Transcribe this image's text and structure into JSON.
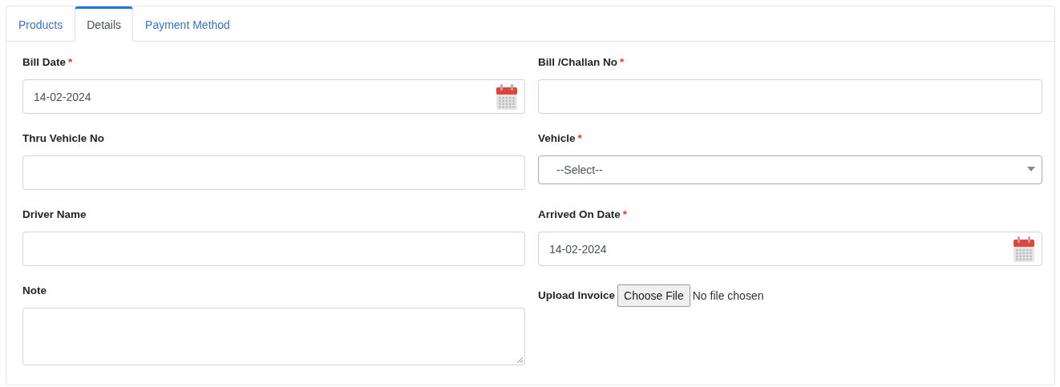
{
  "tabs": [
    {
      "label": "Products",
      "selected": false
    },
    {
      "label": "Details",
      "selected": true
    },
    {
      "label": "Payment Method",
      "selected": false
    }
  ],
  "fields": [
    {
      "kind": "date",
      "label": "Bill Date",
      "required_mark": "*",
      "value": "14-02-2024"
    },
    {
      "kind": "text",
      "label": "Bill /Challan No",
      "required_mark": "*"
    },
    {
      "kind": "text",
      "label": "Thru Vehicle No"
    },
    {
      "kind": "select",
      "label": "Vehicle",
      "required_mark": "*",
      "value": "--Select--"
    },
    {
      "kind": "text",
      "label": "Driver Name"
    },
    {
      "kind": "date",
      "label": "Arrived On Date",
      "required_mark": "*",
      "value": "14-02-2024"
    },
    {
      "kind": "textarea",
      "label": "Note"
    },
    {
      "kind": "file",
      "label": "Upload Invoice",
      "button": "Choose File",
      "status": "No file chosen"
    }
  ]
}
